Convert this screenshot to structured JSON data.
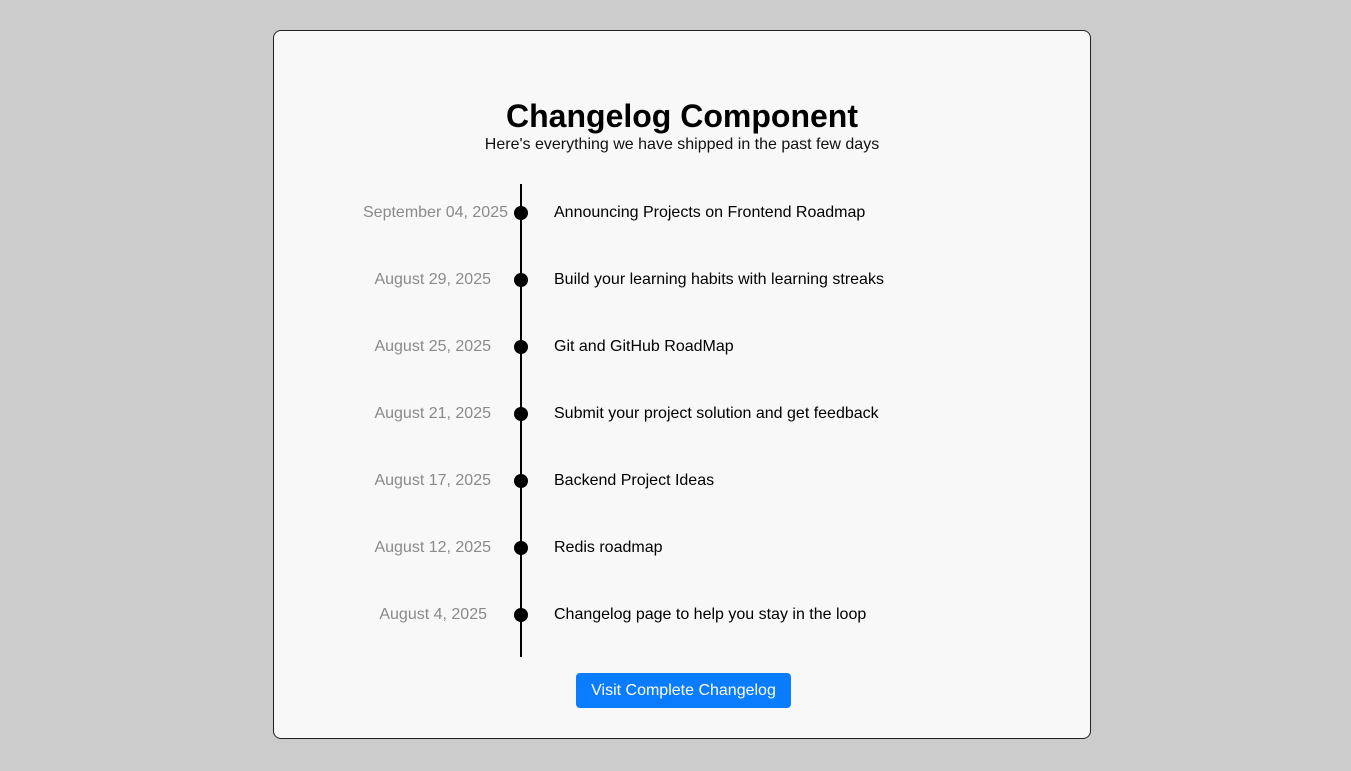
{
  "header": {
    "title": "Changelog Component",
    "subtitle": "Here's everything we have shipped in the past few days"
  },
  "entries": [
    {
      "date": "September 04, 2025",
      "title": "Announcing Projects on Frontend Roadmap"
    },
    {
      "date": "August 29, 2025",
      "title": "Build your learning habits with learning streaks"
    },
    {
      "date": "August 25, 2025",
      "title": "Git and GitHub RoadMap"
    },
    {
      "date": "August 21, 2025",
      "title": "Submit your project solution and get feedback"
    },
    {
      "date": "August 17, 2025",
      "title": "Backend Project Ideas"
    },
    {
      "date": "August 12, 2025",
      "title": "Redis roadmap"
    },
    {
      "date": "August 4, 2025",
      "title": "Changelog page to help you stay in the loop"
    }
  ],
  "footer": {
    "button_label": "Visit Complete Changelog"
  },
  "colors": {
    "page_background": "#cccccc",
    "card_background": "#f8f8f8",
    "accent": "#0a7cff",
    "date_text": "#8a8a8a",
    "timeline": "#000000"
  }
}
